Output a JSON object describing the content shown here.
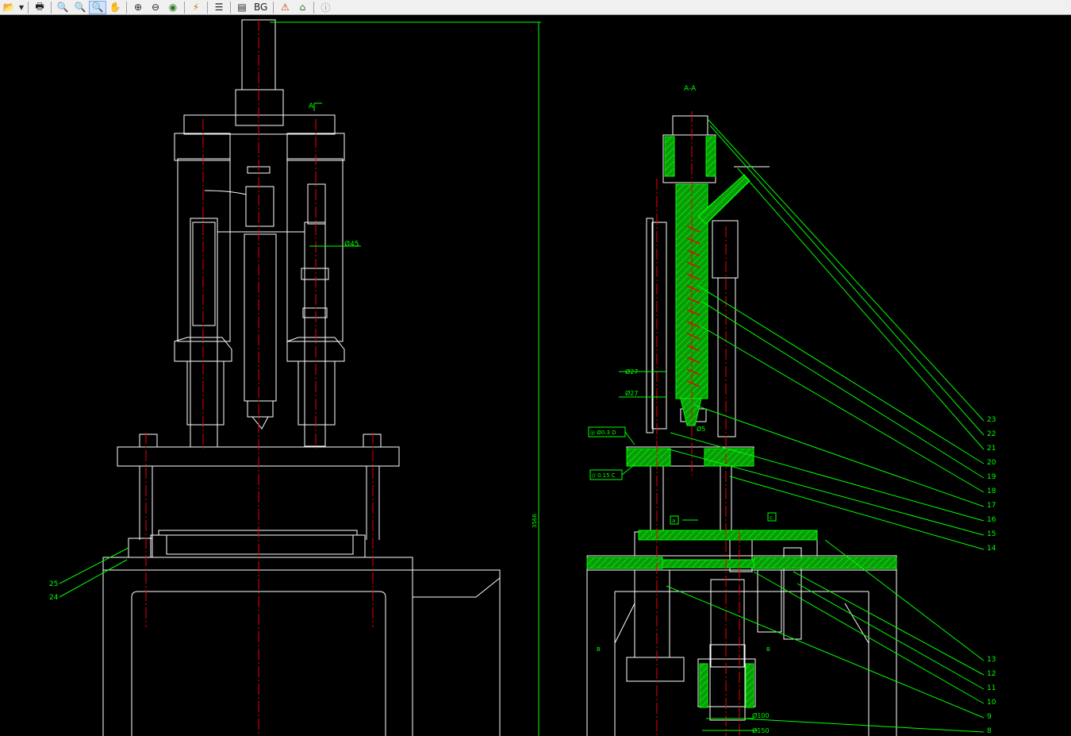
{
  "toolbar": {
    "bg_label": "BG",
    "buttons": [
      {
        "name": "open-icon",
        "glyph": "📂"
      },
      {
        "name": "dropdown-icon",
        "glyph": "▾"
      },
      {
        "name": "print-icon",
        "glyph": "🖶"
      },
      {
        "name": "zoom-out-icon",
        "glyph": "🔍"
      },
      {
        "name": "zoom-in-icon",
        "glyph": "🔍"
      },
      {
        "name": "zoom-window-icon",
        "glyph": "🔍"
      },
      {
        "name": "pan-hand-icon",
        "glyph": "✋"
      },
      {
        "name": "zoom-realtime-icon",
        "glyph": "⊕"
      },
      {
        "name": "zoom-previous-icon",
        "glyph": "⊖"
      },
      {
        "name": "zoom-extents-icon",
        "glyph": "◉"
      },
      {
        "name": "measure-icon",
        "glyph": "⚡"
      },
      {
        "name": "layers-icon",
        "glyph": "☰"
      },
      {
        "name": "properties-icon",
        "glyph": "▤"
      },
      {
        "name": "markup-icon",
        "glyph": "⚠"
      },
      {
        "name": "home-icon",
        "glyph": "⌂"
      },
      {
        "name": "info-icon",
        "glyph": "ⓘ"
      }
    ]
  },
  "drawing": {
    "section_label": "A-A",
    "view_arrow_label": "A",
    "height_dim": "3566",
    "dims": {
      "d1": "Ø45",
      "d2": "Ø27",
      "d3": "Ø27",
      "d4": "Ø5",
      "d5": "Ø100",
      "d6": "Ø150",
      "tol_concentric": "◎ Ø0.3 D",
      "tol_parallel": "// 0.15 C",
      "ref_a": "a",
      "ref_c": "c",
      "ref_b1": "B",
      "ref_b2": "B"
    },
    "callouts_left": [
      "25",
      "24"
    ],
    "callouts_right": [
      "23",
      "22",
      "21",
      "20",
      "19",
      "18",
      "17",
      "16",
      "15",
      "14",
      "13",
      "12",
      "11",
      "10",
      "9",
      "8"
    ]
  }
}
